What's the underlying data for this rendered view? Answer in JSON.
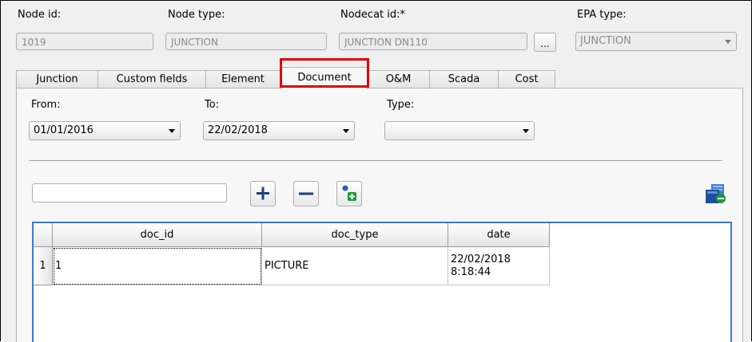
{
  "header": {
    "node_id_label": "Node id:",
    "node_id_value": "1019",
    "node_type_label": "Node type:",
    "node_type_value": "JUNCTION",
    "nodecat_label": "Nodecat id:*",
    "nodecat_value": "JUNCTION DN110",
    "nodecat_button": "...",
    "epa_label": "EPA type:",
    "epa_value": "JUNCTION"
  },
  "tabs": [
    {
      "label": "Junction"
    },
    {
      "label": "Custom fields"
    },
    {
      "label": "Element"
    },
    {
      "label": "Document"
    },
    {
      "label": "O&M"
    },
    {
      "label": "Scada"
    },
    {
      "label": "Cost"
    }
  ],
  "active_tab": "Document",
  "highlight_color": "#e00000",
  "filters": {
    "from_label": "From:",
    "from_value": "01/01/2016",
    "to_label": "To:",
    "to_value": "22/02/2018",
    "type_label": "Type:",
    "type_value": ""
  },
  "toolbar": {
    "search_value": "",
    "add_icon": "plus-icon",
    "remove_icon": "minus-icon",
    "new_doc_icon": "new-document-icon",
    "open_icon": "open-document-icon"
  },
  "table": {
    "columns": [
      "doc_id",
      "doc_type",
      "date"
    ],
    "rows": [
      {
        "index": "1",
        "doc_id": "1",
        "doc_type": "PICTURE",
        "date_line1": "22/02/2018",
        "date_line2": "8:18:44"
      }
    ]
  }
}
